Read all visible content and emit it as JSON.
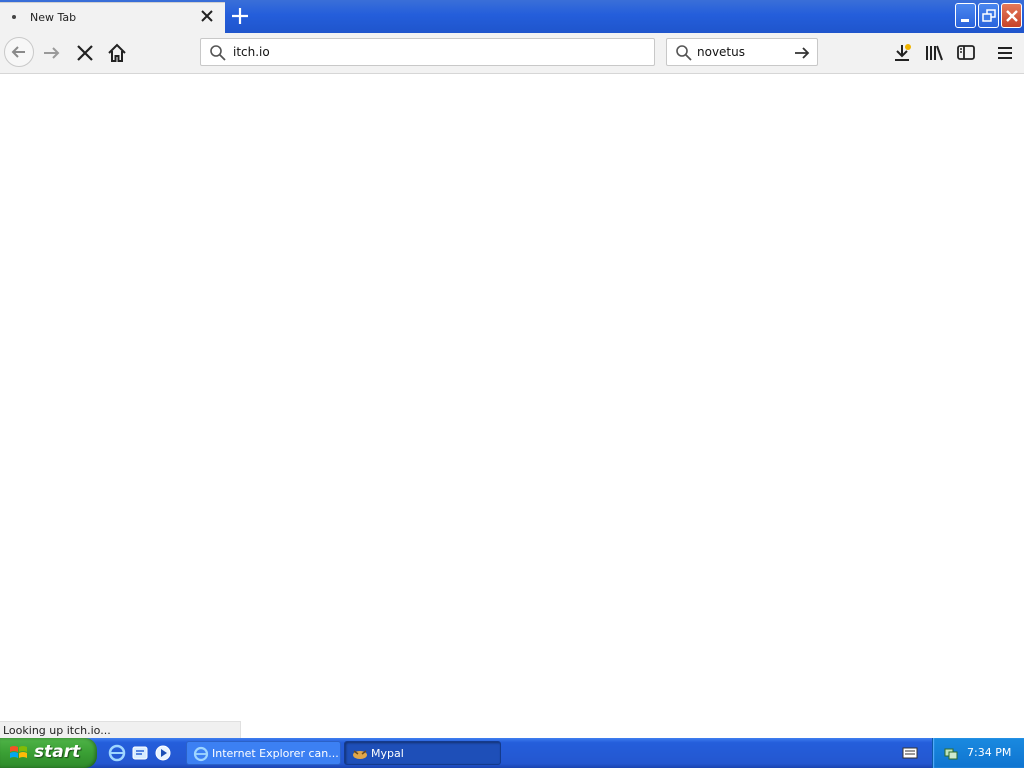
{
  "tab": {
    "title": "New Tab"
  },
  "navbar": {
    "url": "itch.io",
    "search_query": "novetus"
  },
  "status": {
    "text": "Looking up itch.io..."
  },
  "taskbar": {
    "start_label": "start",
    "items": [
      {
        "label": "Internet Explorer can..."
      },
      {
        "label": "Mypal"
      }
    ],
    "clock": "7:34 PM"
  },
  "colors": {
    "titlebar_blue": "#245edb",
    "start_green": "#3a9f34",
    "close_red": "#c64228",
    "tray_blue": "#0f74d0"
  },
  "icons": [
    "back-arrow-icon",
    "forward-arrow-icon",
    "stop-icon",
    "home-icon",
    "search-icon",
    "go-arrow-icon",
    "download-icon",
    "library-icon",
    "sidebar-icon",
    "menu-icon"
  ]
}
